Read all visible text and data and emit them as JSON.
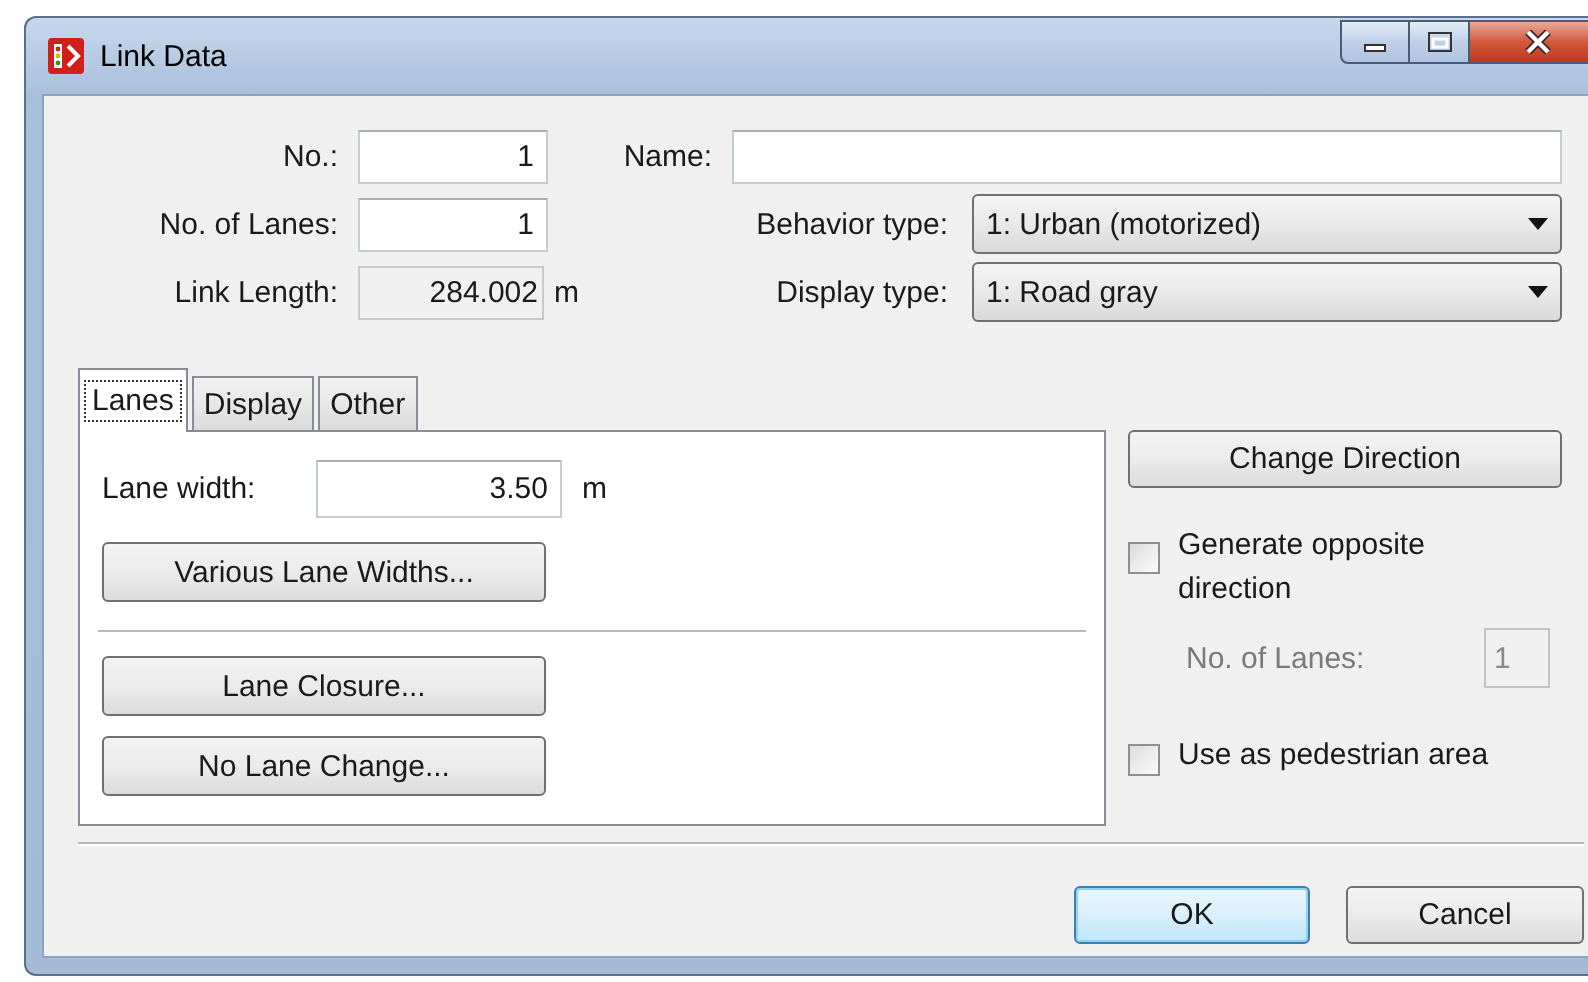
{
  "window": {
    "title": "Link Data"
  },
  "number": {
    "label": "No.:",
    "value": "1"
  },
  "name": {
    "label": "Name:"
  },
  "lanes": {
    "label": "No. of Lanes:",
    "value": "1"
  },
  "behavior_type": {
    "label": "Behavior type:",
    "value": "1: Urban (motorized)"
  },
  "link_length": {
    "label": "Link Length:",
    "value": "284.002",
    "unit": "m",
    "readonly": true
  },
  "display_type": {
    "label": "Display type:",
    "value": "1: Road gray"
  },
  "tabs": [
    {
      "label": "Lanes",
      "selected": true
    },
    {
      "label": "Display",
      "selected": false
    },
    {
      "label": "Other",
      "selected": false
    }
  ],
  "lanes_panel": {
    "lane_width": {
      "label": "Lane width:",
      "value": "3.50",
      "unit": "m"
    },
    "buttons": [
      "Various Lane Widths...",
      "Lane Closure...",
      "No Lane Change..."
    ]
  },
  "side": {
    "change_direction": "Change Direction",
    "generate_opposite": {
      "label": "Generate opposite direction",
      "checked": false
    },
    "opposite_lanes": {
      "label": "No. of Lanes:",
      "value": "1",
      "disabled": true
    },
    "pedestrian_area": {
      "label": "Use as pedestrian area",
      "checked": false
    }
  },
  "buttons": [
    {
      "label": "OK",
      "default": true
    },
    {
      "label": "Cancel",
      "default": false
    }
  ]
}
